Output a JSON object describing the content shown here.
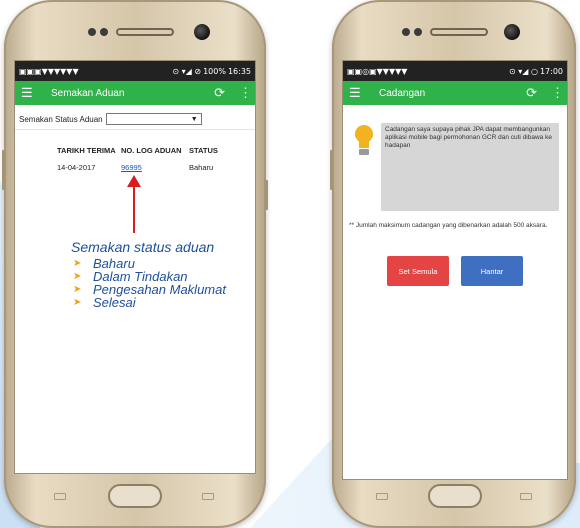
{
  "left_phone": {
    "status_bar": {
      "battery": "100%",
      "time": "16:35"
    },
    "app_bar": {
      "title": "Semakan Aduan"
    },
    "filter": {
      "label": "Semakan Status Aduan",
      "selected": ""
    },
    "table": {
      "headers": [
        "TARIKH TERIMA",
        "NO. LOG ADUAN",
        "STATUS"
      ],
      "rows": [
        {
          "date": "14-04-2017",
          "log_no": "96995",
          "status": "Baharu"
        }
      ]
    },
    "annotation": {
      "heading": "Semakan status aduan",
      "items": [
        "Baharu",
        "Dalam Tindakan",
        "Pengesahan Maklumat",
        "Selesai"
      ]
    }
  },
  "right_phone": {
    "status_bar": {
      "time": "17:00"
    },
    "app_bar": {
      "title": "Cadangan"
    },
    "suggestion_text": "Cadangan saya supaya pihak JPA dapat membangunkan aplikasi mobile bagi permohonan GCR dan cuti dibawa ke hadapan",
    "note": "** Jumlah maksimum cadangan yang dibenarkan adalah 500 aksara.",
    "buttons": {
      "reset": "Set Semula",
      "submit": "Hantar"
    }
  },
  "colors": {
    "app_bar": "#2fb24a",
    "link": "#1a57c9",
    "arrow": "#d81d1d",
    "annotation": "#1d4f9a",
    "bullet": "#f2a11c",
    "reset_button": "#e54444",
    "submit_button": "#3e6fc0"
  },
  "icons": [
    "menu-icon",
    "refresh-icon",
    "more-icon",
    "lightbulb-icon",
    "dropdown-arrow-icon",
    "home-button-icon"
  ]
}
